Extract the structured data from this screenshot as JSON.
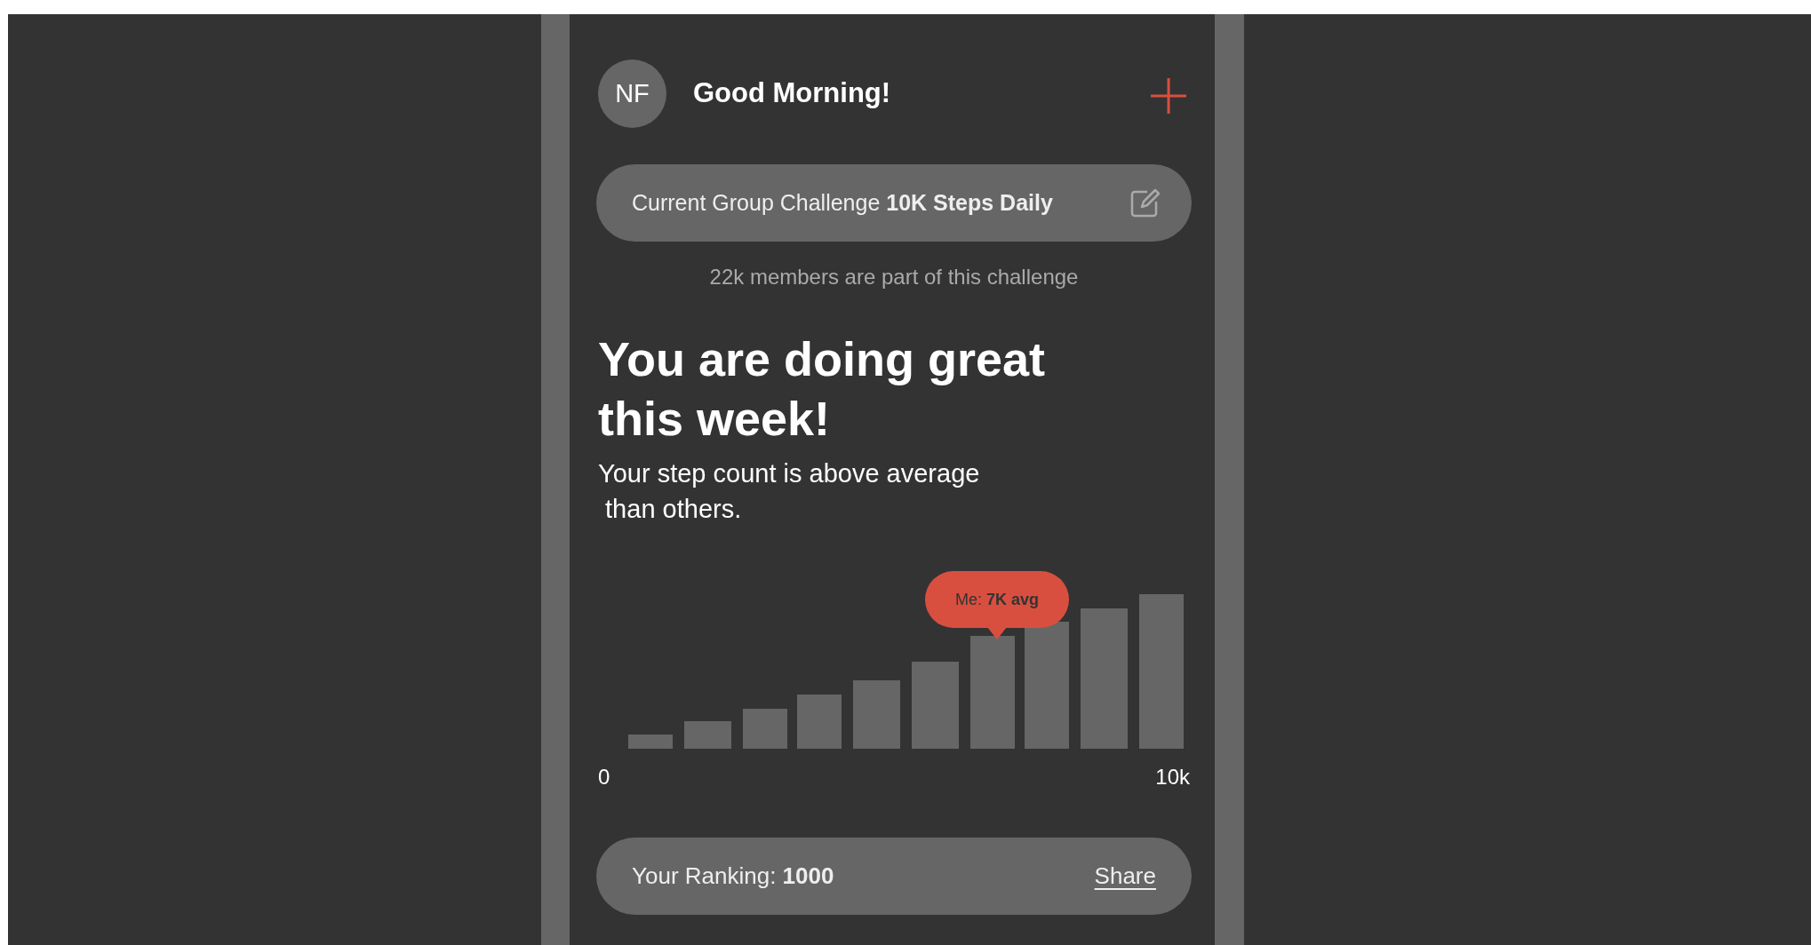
{
  "header": {
    "avatar": "NF",
    "greeting": "Good Morning!"
  },
  "challenge": {
    "label": "Current Group Challenge **10K Steps Daily**"
  },
  "members_note": "22k members are part of this challenge",
  "headline": "You are doing great this week!",
  "subtext": "Your step count is above average\n than others.",
  "chart": {
    "tooltip": "Me: **7K avg**",
    "axis_start": "0",
    "axis_end": "10k"
  },
  "ranking": {
    "label": "Your Ranking: **1000**",
    "share": "Share"
  }
}
